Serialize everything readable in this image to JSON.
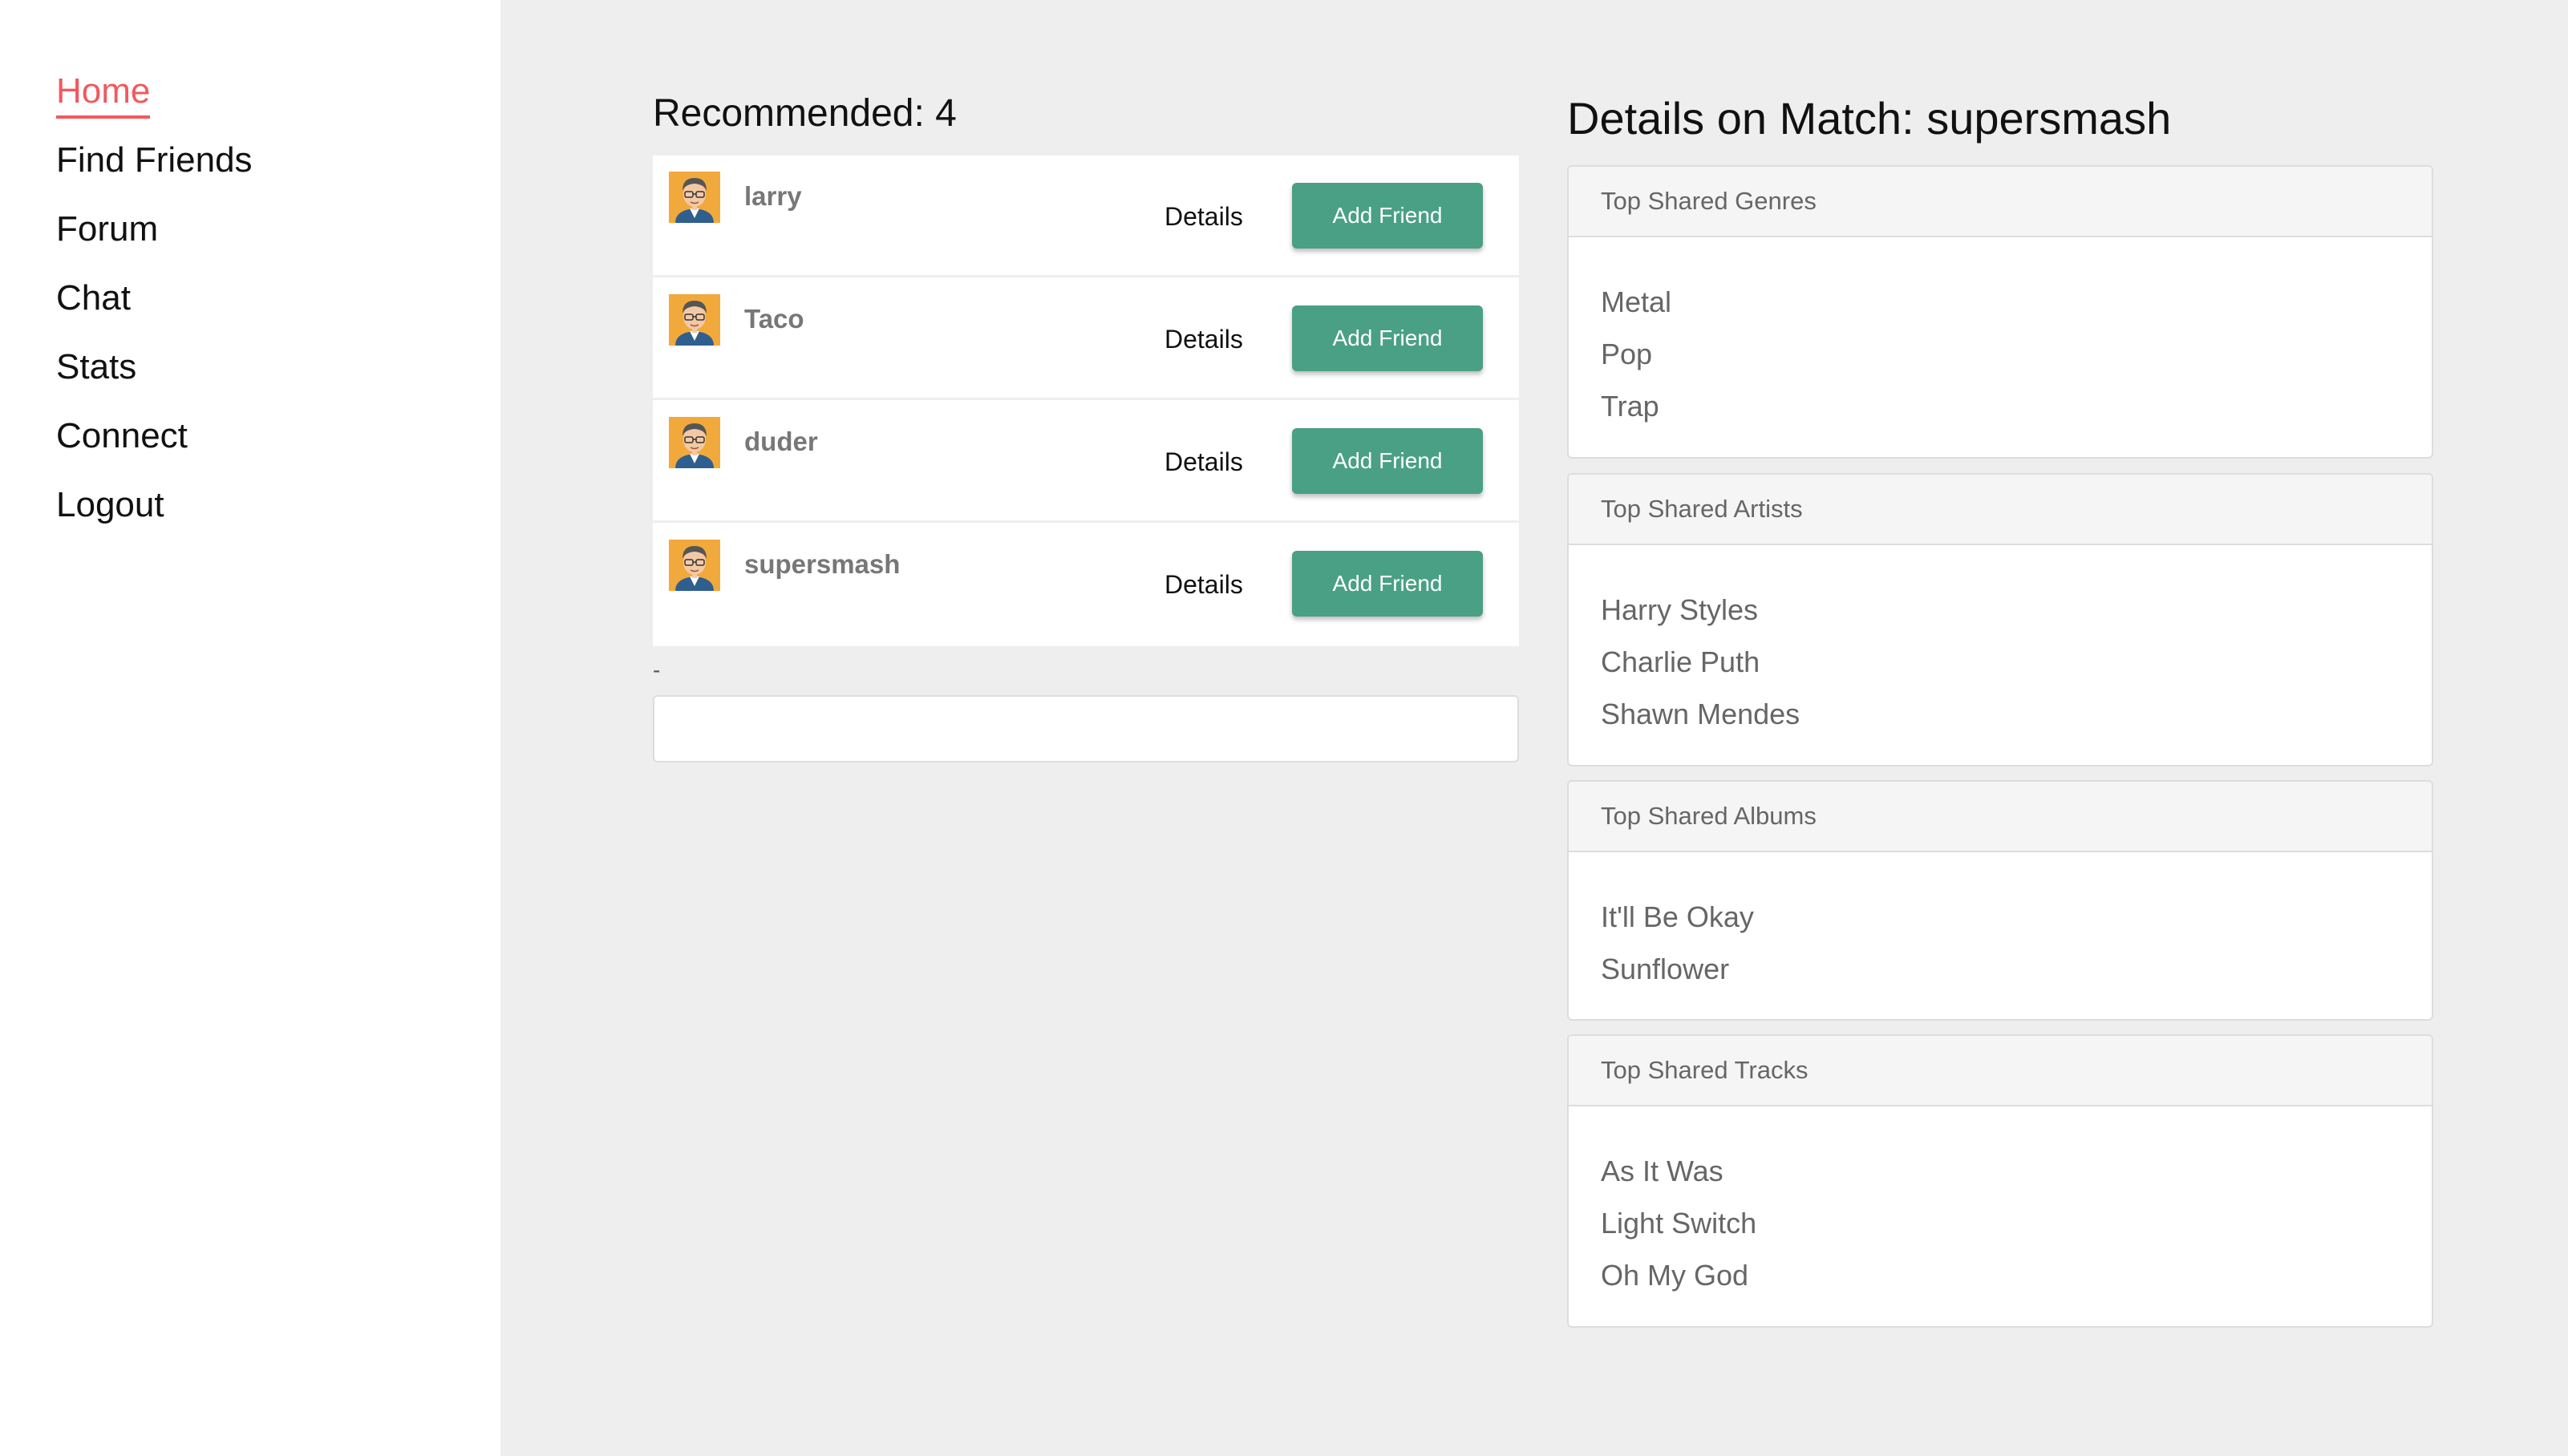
{
  "nav": {
    "items": [
      {
        "label": "Home",
        "active": true
      },
      {
        "label": "Find Friends",
        "active": false
      },
      {
        "label": "Forum",
        "active": false
      },
      {
        "label": "Chat",
        "active": false
      },
      {
        "label": "Stats",
        "active": false
      },
      {
        "label": "Connect",
        "active": false
      },
      {
        "label": "Logout",
        "active": false
      }
    ]
  },
  "recommended": {
    "title": "Recommended: 4",
    "users": [
      {
        "name": "larry",
        "details_label": "Details",
        "action_label": "Add Friend"
      },
      {
        "name": "Taco",
        "details_label": "Details",
        "action_label": "Add Friend"
      },
      {
        "name": "duder",
        "details_label": "Details",
        "action_label": "Add Friend"
      },
      {
        "name": "supersmash",
        "details_label": "Details",
        "action_label": "Add Friend"
      }
    ],
    "separator": "-"
  },
  "details": {
    "title": "Details on Match: supersmash",
    "sections": [
      {
        "heading": "Top Shared Genres",
        "items": [
          "Metal",
          "Pop",
          "Trap"
        ]
      },
      {
        "heading": "Top Shared Artists",
        "items": [
          "Harry Styles",
          "Charlie Puth",
          "Shawn Mendes"
        ]
      },
      {
        "heading": "Top Shared Albums",
        "items": [
          "It'll Be Okay",
          "Sunflower"
        ]
      },
      {
        "heading": "Top Shared Tracks",
        "items": [
          "As It Was",
          "Light Switch",
          "Oh My God"
        ]
      }
    ]
  },
  "colors": {
    "accent_active": "#f05a5f",
    "button_green": "#4aa084",
    "avatar_bg": "#f2a93b"
  },
  "icons": {
    "avatar": "user-avatar-icon"
  }
}
